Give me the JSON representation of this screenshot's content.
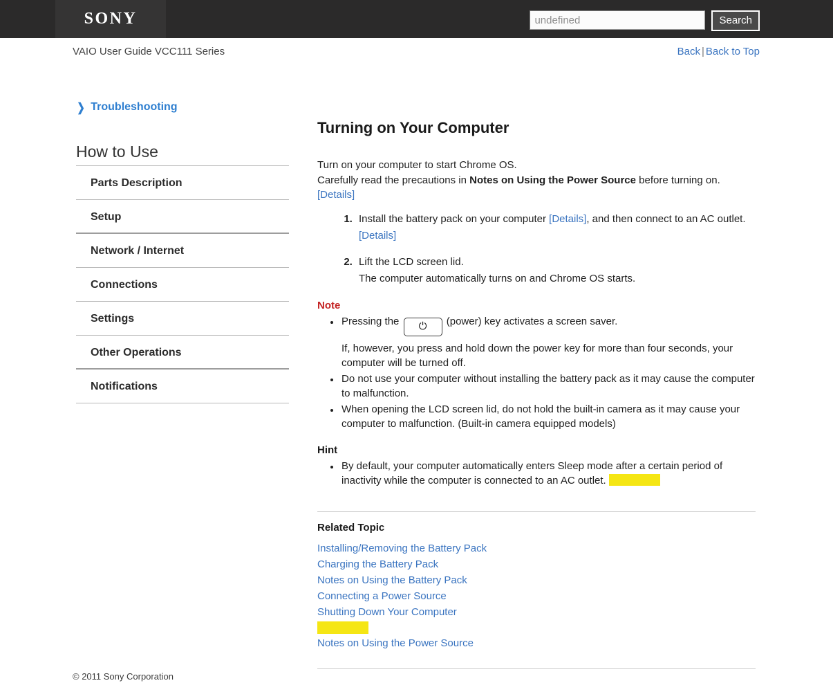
{
  "header": {
    "logo_text": "SONY",
    "search": {
      "value": "undefined",
      "placeholder": "undefined",
      "button_label": "Search"
    }
  },
  "subheader": {
    "guide_title": "VAIO User Guide VCC111 Series",
    "back_label": "Back",
    "separator": "|",
    "back_to_top_label": "Back to Top"
  },
  "sidebar": {
    "troubleshooting_label": "Troubleshooting",
    "chevron_glyph": "❯",
    "section_title": "How to Use",
    "items": [
      {
        "label": "Parts Description"
      },
      {
        "label": "Setup"
      },
      {
        "label": "Network / Internet"
      },
      {
        "label": "Connections"
      },
      {
        "label": "Settings"
      },
      {
        "label": "Other Operations"
      },
      {
        "label": "Notifications"
      }
    ]
  },
  "main": {
    "title": "Turning on Your Computer",
    "intro_line1": "Turn on your computer to start Chrome OS.",
    "intro_line2_pre": "Carefully read the precautions in ",
    "intro_line2_bold": "Notes on Using the Power Source",
    "intro_line2_post": " before turning on.",
    "intro_details_link": "[Details]",
    "steps": [
      {
        "text_pre": "Install the battery pack on your computer ",
        "link1": "[Details]",
        "text_mid": ", and then connect to an AC outlet.",
        "link2": "[Details]"
      },
      {
        "text_pre": "Lift the LCD screen lid.",
        "text_sub": "The computer automatically turns on and Chrome OS starts."
      }
    ],
    "note_label": "Note",
    "note_bullets": [
      {
        "pre": "Pressing the",
        "key_glyph": "⏻",
        "post": "(power) key activates a screen saver.",
        "sub": "If, however, you press and hold down the power key for more than four seconds, your computer will be turned off."
      },
      {
        "text": "Do not use your computer without installing the battery pack as it may cause the computer to malfunction."
      },
      {
        "text": "When opening the LCD screen lid, do not hold the built-in camera as it may cause your computer to malfunction. (Built-in camera equipped models)"
      }
    ],
    "hint_label": "Hint",
    "hint_bullets": [
      {
        "text": "By default, your computer automatically enters Sleep mode after a certain period of inactivity while the computer is connected to an AC outlet.",
        "highlight": true
      }
    ],
    "related_topic_label": "Related Topic",
    "related_topics": [
      {
        "label": "Installing/Removing the Battery Pack",
        "highlight": false
      },
      {
        "label": "Charging the Battery Pack",
        "highlight": false
      },
      {
        "label": "Notes on Using the Battery Pack",
        "highlight": false
      },
      {
        "label": "Connecting a Power Source",
        "highlight": false
      },
      {
        "label": "Shutting Down Your Computer",
        "highlight": false
      },
      {
        "label": "",
        "highlight": true
      },
      {
        "label": "Notes on Using the Power Source",
        "highlight": false
      }
    ]
  },
  "footer": {
    "copyright": "© 2011 Sony Corporation"
  },
  "colors": {
    "header_bg": "#2b2a2a",
    "logo_bg": "#353434",
    "link_blue": "#3a74c0",
    "note_red": "#c42323",
    "highlight_yellow": "#f5e614"
  }
}
